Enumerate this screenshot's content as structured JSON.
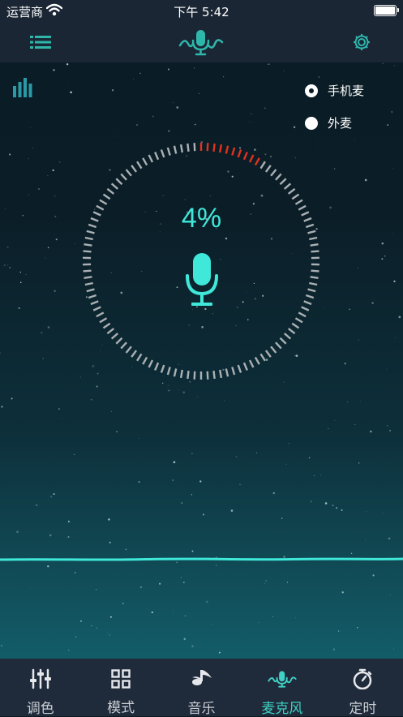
{
  "status_bar": {
    "carrier": "运营商",
    "time": "下午 5:42"
  },
  "nav": {
    "menu_icon": "list-icon",
    "center_icon": "microphone-wave-icon",
    "settings_icon": "gear-icon"
  },
  "mic_source": {
    "options": [
      {
        "label": "手机麦",
        "selected": true
      },
      {
        "label": "外麦",
        "selected": false
      }
    ]
  },
  "meter": {
    "level_text": "4%",
    "level_value": 0.04,
    "accent_color": "#3fe8d8",
    "active_segment_color": "#e0321e",
    "inactive_segment_color": "#aab0b3"
  },
  "tabs": [
    {
      "label": "调色",
      "icon": "sliders-icon",
      "active": false
    },
    {
      "label": "模式",
      "icon": "grid-icon",
      "active": false
    },
    {
      "label": "音乐",
      "icon": "music-note-icon",
      "active": false
    },
    {
      "label": "麦克风",
      "icon": "microphone-wave-icon",
      "active": true
    },
    {
      "label": "定时",
      "icon": "timer-icon",
      "active": false
    }
  ]
}
